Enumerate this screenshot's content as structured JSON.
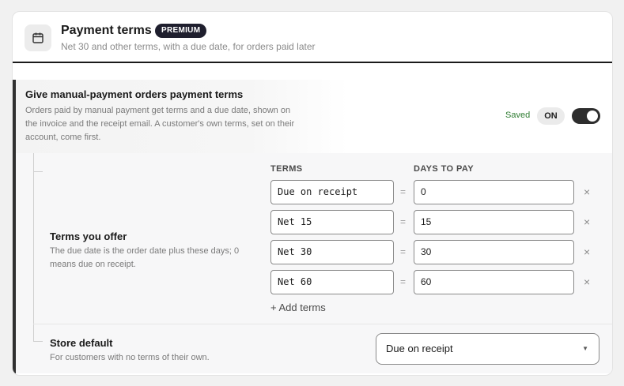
{
  "card": {
    "title": "Payment terms",
    "badge": "PREMIUM",
    "subtitle": "Net 30 and other terms, with a due date, for orders paid later",
    "icon": "calendar-icon"
  },
  "manual_terms": {
    "title": "Give manual-payment orders payment terms",
    "description": "Orders paid by manual payment get terms and a due date, shown on the invoice and the receipt email. A customer's own terms, set on their account, come first.",
    "saved_label": "Saved",
    "state_label": "ON",
    "enabled": true
  },
  "terms_offer": {
    "title": "Terms you offer",
    "description": "The due date is the order date plus these days; 0 means due on receipt.",
    "col_terms": "TERMS",
    "col_days": "DAYS TO PAY",
    "equals": "=",
    "remove_symbol": "×",
    "rows": [
      {
        "term": "Due on receipt",
        "days": "0"
      },
      {
        "term": "Net 15",
        "days": "15"
      },
      {
        "term": "Net 30",
        "days": "30"
      },
      {
        "term": "Net 60",
        "days": "60"
      }
    ],
    "add_label": "+ Add terms"
  },
  "store_default": {
    "title": "Store default",
    "description": "For customers with no terms of their own.",
    "selected": "Due on receipt",
    "caret": "▼"
  },
  "colors": {
    "accent_dark": "#1a1a1a",
    "saved_green": "#2f7d32",
    "badge_bg": "#1f1f2e"
  }
}
